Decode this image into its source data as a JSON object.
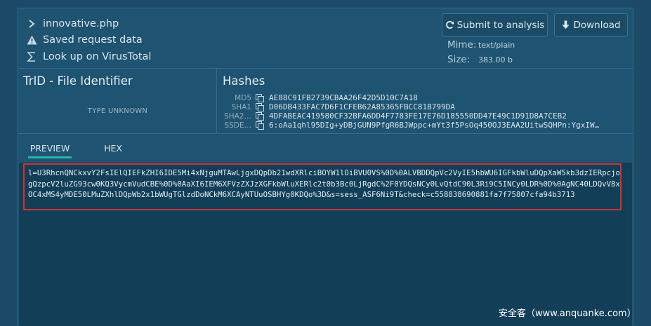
{
  "file": {
    "name": "innovative.php",
    "saved_request": "Saved request data",
    "virustotal": "Look up on VirusTotal"
  },
  "actions": {
    "submit": "Submit to analysis",
    "download": "Download"
  },
  "meta": {
    "mime_label": "Mime:",
    "mime_value": "text/plain",
    "size_label": "Size:",
    "size_value": "383.00 b"
  },
  "trid": {
    "title": "TrID - File Identifier",
    "value": "TYPE UNKNOWN"
  },
  "hashes": {
    "title": "Hashes",
    "rows": [
      {
        "key": "MD5",
        "value": "AE88C91FB2739CBAA26F42D5D10C7A18"
      },
      {
        "key": "SHA1",
        "value": "D06DB433FAC7D6F1CFEB62A85365FBCC81B799DA"
      },
      {
        "key": "SHA2…",
        "value": "4DFABEAC419580CF32BFA6DD4F7783FE17E76D185550DD47E49C1D91D8A7CEB2"
      },
      {
        "key": "SSDE…",
        "value": "6:oAa1qhl95DIg+yDBjGUN9PfgR6BJWppc+mYt3f5PsOq450OJ3EAA2UitwSQHPn:YgxIW…"
      }
    ]
  },
  "tabs": {
    "preview": "PREVIEW",
    "hex": "HEX"
  },
  "preview": {
    "content": "l=U3RhcnQNCkxvY2FsIElQIEFkZHI6IDE5Mi4xNjguMTAwLjgxDQpDb21wdXRlciBOYW1lOiBVU0VS%0D%0ALVBDDQpVc2VyIE5hbWU6IGFkbWluDQpXaW5kb3dzIERpcjogQzpcV2luZG93cw0KQ3VycmVudCBE%0D%0AaXI6IEM6XFVzZXJzXGFkbWluXERlc2t0b3Bc0LjRgdC%2F0YDQsNCy0LvQtdC90L3Ri9C5INCy0LDR%0D%0AgNC40LDQvV8xOC4xMS4yMDE50LMuZXhlDQpWb2x1bWUgTGlzdDoNCkM6XCAyNTUuOSBHYg0KDQo%3D&s=sess_ASF6Ni9T&check=c558838690881fa7f75807cfa94b3713"
  },
  "watermark": "安全客（www.anquanke.com）"
}
